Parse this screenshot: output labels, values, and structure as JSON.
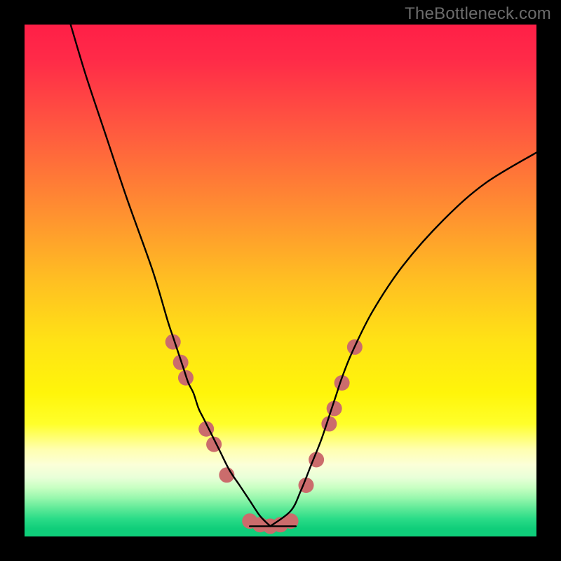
{
  "watermark": {
    "text": "TheBottleneck.com"
  },
  "chart_data": {
    "type": "line",
    "title": "",
    "xlabel": "",
    "ylabel": "",
    "xlim": [
      0,
      100
    ],
    "ylim": [
      0,
      100
    ],
    "series": [
      {
        "name": "bottleneck-curve-left",
        "x_pct": [
          9,
          12,
          16,
          20,
          25,
          28,
          29,
          30,
          31,
          32,
          33,
          34,
          35,
          38,
          40,
          42,
          44,
          46,
          48
        ],
        "y_pct": [
          100,
          90,
          78,
          66,
          52,
          42,
          39,
          36,
          33,
          30,
          28,
          25,
          23,
          17,
          13,
          10,
          7,
          4,
          2
        ]
      },
      {
        "name": "bottleneck-curve-right",
        "x_pct": [
          48,
          52,
          54,
          56,
          58,
          60,
          61,
          62,
          64,
          68,
          74,
          82,
          90,
          100
        ],
        "y_pct": [
          2,
          5,
          9,
          14,
          19,
          25,
          28,
          31,
          36,
          44,
          53,
          62,
          69,
          75
        ]
      }
    ],
    "flat_region_x_pct": [
      44,
      53
    ],
    "markers": {
      "name": "sample-points",
      "color": "#cb6c6c",
      "radius_px": 11,
      "points": [
        {
          "x_pct": 29.0,
          "y_pct": 38
        },
        {
          "x_pct": 30.5,
          "y_pct": 34
        },
        {
          "x_pct": 31.5,
          "y_pct": 31
        },
        {
          "x_pct": 35.5,
          "y_pct": 21
        },
        {
          "x_pct": 37.0,
          "y_pct": 18
        },
        {
          "x_pct": 39.5,
          "y_pct": 12
        },
        {
          "x_pct": 44.0,
          "y_pct": 3.0
        },
        {
          "x_pct": 46.0,
          "y_pct": 2.3
        },
        {
          "x_pct": 48.0,
          "y_pct": 2.0
        },
        {
          "x_pct": 50.0,
          "y_pct": 2.3
        },
        {
          "x_pct": 52.0,
          "y_pct": 3.0
        },
        {
          "x_pct": 55.0,
          "y_pct": 10
        },
        {
          "x_pct": 57.0,
          "y_pct": 15
        },
        {
          "x_pct": 59.5,
          "y_pct": 22
        },
        {
          "x_pct": 60.5,
          "y_pct": 25
        },
        {
          "x_pct": 62.0,
          "y_pct": 30
        },
        {
          "x_pct": 64.5,
          "y_pct": 37
        }
      ]
    },
    "gradient_stops": [
      {
        "offset": 0.0,
        "color": "#ff1f47"
      },
      {
        "offset": 0.07,
        "color": "#ff2b48"
      },
      {
        "offset": 0.2,
        "color": "#ff5740"
      },
      {
        "offset": 0.35,
        "color": "#ff8a32"
      },
      {
        "offset": 0.5,
        "color": "#ffbf22"
      },
      {
        "offset": 0.62,
        "color": "#ffe315"
      },
      {
        "offset": 0.72,
        "color": "#fff50a"
      },
      {
        "offset": 0.78,
        "color": "#ffff2a"
      },
      {
        "offset": 0.83,
        "color": "#ffffb0"
      },
      {
        "offset": 0.86,
        "color": "#fbffd8"
      },
      {
        "offset": 0.885,
        "color": "#e8ffd8"
      },
      {
        "offset": 0.905,
        "color": "#c7ffc2"
      },
      {
        "offset": 0.925,
        "color": "#97f7ad"
      },
      {
        "offset": 0.945,
        "color": "#5fea98"
      },
      {
        "offset": 0.965,
        "color": "#2bdc88"
      },
      {
        "offset": 0.985,
        "color": "#0fce7a"
      },
      {
        "offset": 1.0,
        "color": "#0fce7a"
      }
    ]
  }
}
